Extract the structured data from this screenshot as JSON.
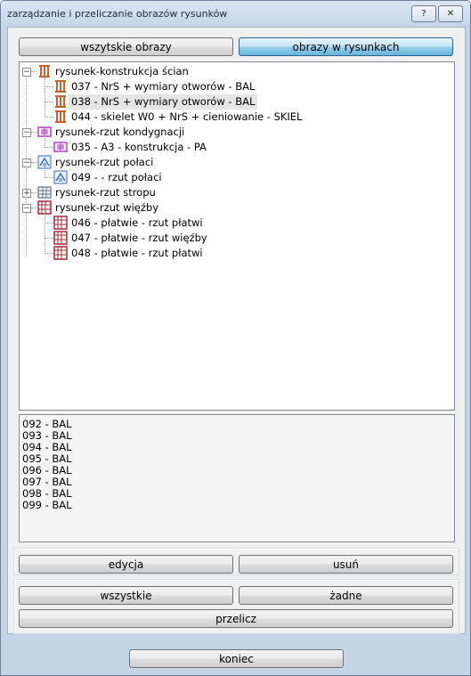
{
  "window": {
    "title": "zarządzanie i przeliczanie obrazów rysunków",
    "help_label": "?",
    "close_label": "✕"
  },
  "tabs": {
    "all_label": "wszytskie obrazy",
    "drawings_label": "obrazy w rysunkach"
  },
  "tree": [
    {
      "label": "rysunek-konstrukcja ścian",
      "children": [
        {
          "label": "037 - NrS + wymiary otworów - BAL"
        },
        {
          "label": "038 - NrS + wymiary otworów - BAL",
          "selected": true
        },
        {
          "label": "044 - skielet W0 + NrS + cieniowanie - SKIEL"
        }
      ]
    },
    {
      "label": "rysunek-rzut kondygnacji",
      "children": [
        {
          "label": "035 - A3 - konstrukcja - PA"
        }
      ]
    },
    {
      "label": "rysunek-rzut połaci",
      "children": [
        {
          "label": "049 -  - rzut połaci"
        }
      ]
    },
    {
      "label": "rysunek-rzut stropu",
      "collapsed": true,
      "children": []
    },
    {
      "label": "rysunek-rzut więźby",
      "children": [
        {
          "label": "046 - płatwie - rzut płatwi"
        },
        {
          "label": "047 - płatwie - rzut więźby"
        },
        {
          "label": "048 - płatwie - rzut płatwi"
        }
      ]
    }
  ],
  "list": [
    "092 - BAL",
    "093 - BAL",
    "094 - BAL",
    "095 - BAL",
    "096 - BAL",
    "097 - BAL",
    "098 - BAL",
    "099 - BAL"
  ],
  "buttons": {
    "edit": "edycja",
    "remove": "usuń",
    "all": "wszystkie",
    "none": "żadne",
    "recalc": "przelicz",
    "finish": "koniec"
  },
  "colors": {
    "wall_icon": "#c8642a",
    "floor_icon": "#b43cc8",
    "roof_icon": "#3a6ec8",
    "rafter_icon": "#a82a3a"
  }
}
